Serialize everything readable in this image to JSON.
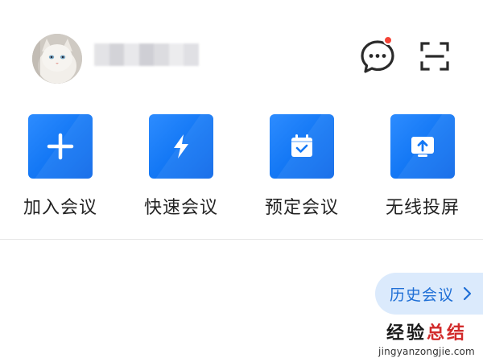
{
  "header": {
    "messages_badge": true
  },
  "actions": [
    {
      "label": "加入会议",
      "icon": "plus-icon"
    },
    {
      "label": "快速会议",
      "icon": "lightning-icon"
    },
    {
      "label": "预定会议",
      "icon": "calendar-check-icon"
    },
    {
      "label": "无线投屏",
      "icon": "screen-share-icon"
    }
  ],
  "history": {
    "label": "历史会议",
    "icon": "chevron-right-icon"
  },
  "watermark": {
    "title_part1": "经验",
    "title_part2": "总结",
    "url": "jingyanzongjie.com"
  },
  "colors": {
    "accent": "#1478f5",
    "history_bg": "#dbeafc",
    "badge": "#f44336"
  }
}
